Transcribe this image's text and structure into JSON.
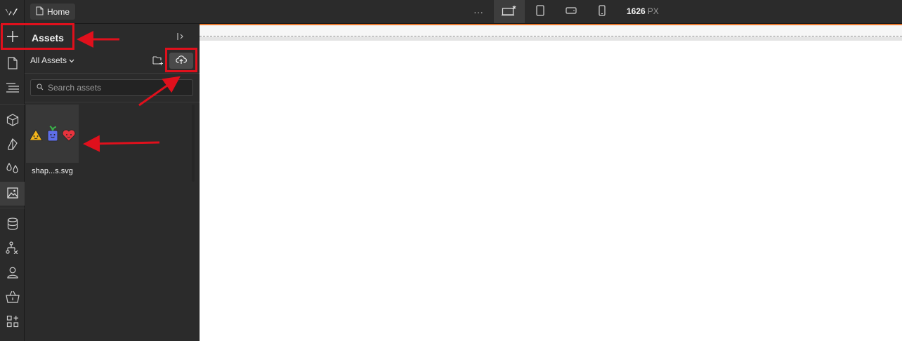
{
  "topbar": {
    "logo_icon": "webflow-logo-icon",
    "page_label": "Home",
    "more_label": "···",
    "breakpoints": [
      "desktop-base-icon",
      "tablet-icon",
      "mobile-landscape-icon",
      "mobile-portrait-icon"
    ],
    "width_value": "1626",
    "width_unit": "PX"
  },
  "rail": {
    "items": [
      "add-icon",
      "pages-icon",
      "navigator-icon",
      "components-icon",
      "style-selectors-icon",
      "variables-icon",
      "assets-icon",
      "cms-icon",
      "logic-icon",
      "users-icon",
      "ecommerce-icon",
      "apps-icon"
    ],
    "active": "assets-icon"
  },
  "assets_panel": {
    "title": "Assets",
    "filter_label": "All Assets",
    "search": {
      "placeholder": "Search assets",
      "value": ""
    },
    "assets": [
      {
        "name": "shap...s.svg"
      }
    ]
  },
  "colors": {
    "annotation_red": "#e0101c",
    "canvas_accent": "#e9792e",
    "panel_bg": "#2b2b2b"
  }
}
